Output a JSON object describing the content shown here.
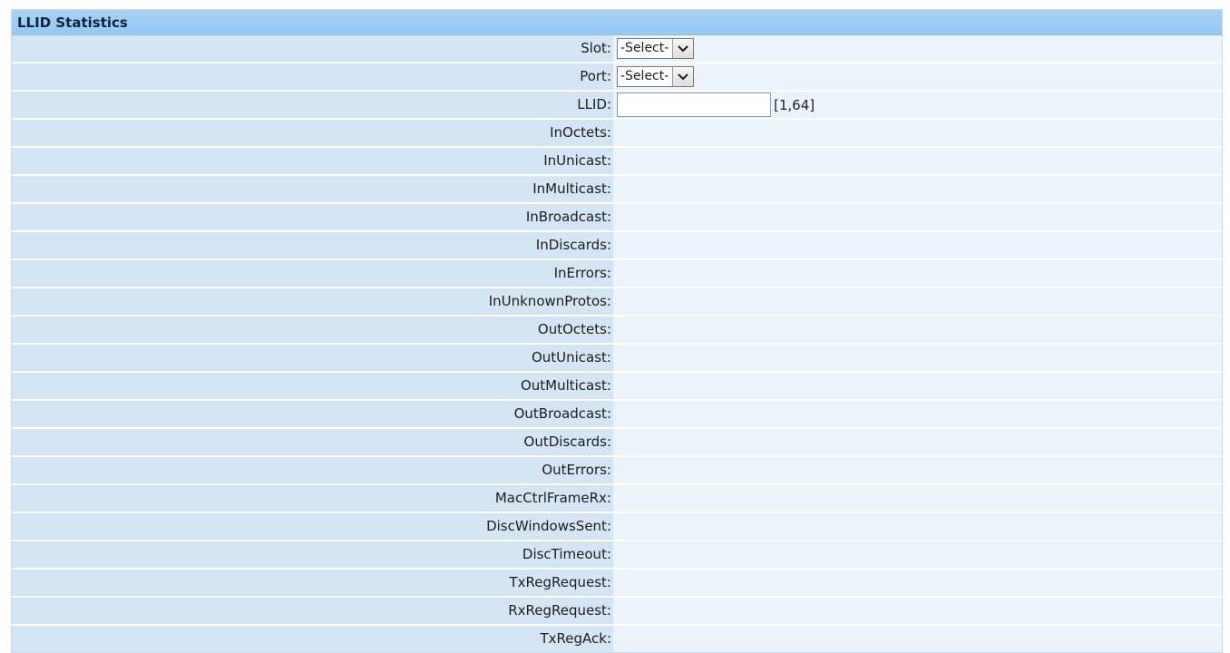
{
  "panel": {
    "title": "LLID Statistics"
  },
  "form": {
    "slot": {
      "label": "Slot:",
      "selected": "-Select-"
    },
    "port": {
      "label": "Port:",
      "selected": "-Select-"
    },
    "llid": {
      "label": "LLID:",
      "value": "",
      "range_hint": "[1,64]"
    }
  },
  "stats": [
    {
      "label": "InOctets:",
      "value": ""
    },
    {
      "label": "InUnicast:",
      "value": ""
    },
    {
      "label": "InMulticast:",
      "value": ""
    },
    {
      "label": "InBroadcast:",
      "value": ""
    },
    {
      "label": "InDiscards:",
      "value": ""
    },
    {
      "label": "InErrors:",
      "value": ""
    },
    {
      "label": "InUnknownProtos:",
      "value": ""
    },
    {
      "label": "OutOctets:",
      "value": ""
    },
    {
      "label": "OutUnicast:",
      "value": ""
    },
    {
      "label": "OutMulticast:",
      "value": ""
    },
    {
      "label": "OutBroadcast:",
      "value": ""
    },
    {
      "label": "OutDiscards:",
      "value": ""
    },
    {
      "label": "OutErrors:",
      "value": ""
    },
    {
      "label": "MacCtrlFrameRx:",
      "value": ""
    },
    {
      "label": "DiscWindowsSent:",
      "value": ""
    },
    {
      "label": "DiscTimeout:",
      "value": ""
    },
    {
      "label": "TxRegRequest:",
      "value": ""
    },
    {
      "label": "RxRegRequest:",
      "value": ""
    },
    {
      "label": "TxRegAck:",
      "value": ""
    }
  ],
  "colors": {
    "title_bar": "#a7d2f5",
    "label_cell": "#d6e5f3",
    "value_cell": "#ebf3fb"
  }
}
